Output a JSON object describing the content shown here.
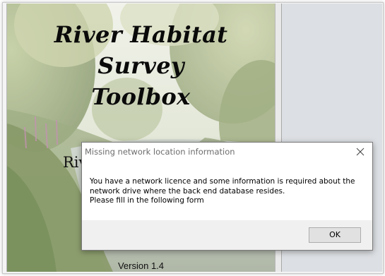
{
  "splash": {
    "title_lines": [
      "River Habitat",
      "Survey",
      "Toolbox"
    ],
    "subtitle_partial": "Riv",
    "version": "Version 1.4"
  },
  "dialog": {
    "title": "Missing network location information",
    "close_icon": "close-icon",
    "message_lines": [
      "You have a network licence and some information is required about the",
      "network drive where the back end database resides.",
      "Please fill in the following form"
    ],
    "ok_label": "OK"
  },
  "colors": {
    "dialog_footer": "#f0f0f0",
    "button_face": "#e1e1e1",
    "button_border": "#adadad",
    "right_panel": "#dcdfe3",
    "title_text": "#6d6d6d"
  }
}
